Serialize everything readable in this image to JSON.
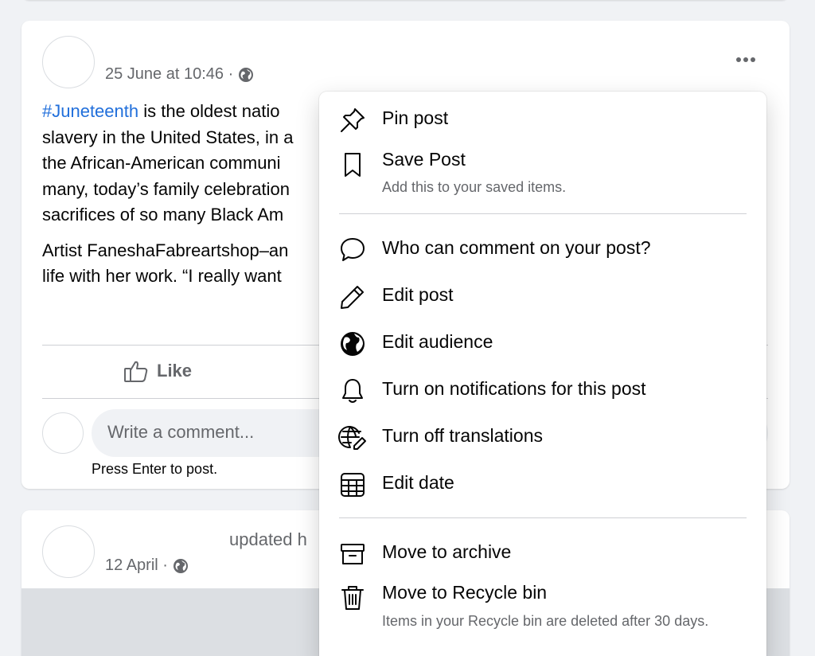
{
  "post1": {
    "timestamp": "25 June at 10:46 ·",
    "hashtag": "#Juneteenth",
    "line1": " is the oldest natio",
    "line2": "slavery in the United States, in a",
    "line3": "the African-American communi",
    "line4": "many, today’s family celebration",
    "line5": "sacrifices of so many Black Am",
    "line6": "Artist FaneshaFabreartshop–an",
    "line7": "life with her work. “I really want",
    "like_label": "Like",
    "comment_placeholder": "Write a comment...",
    "press_enter": "Press Enter to post."
  },
  "post2": {
    "updated_text": "updated h",
    "timestamp": "12 April ·"
  },
  "menu": {
    "pin_post": "Pin post",
    "save_post": "Save Post",
    "save_post_sub": "Add this to your saved items.",
    "who_can_comment": "Who can comment on your post?",
    "edit_post": "Edit post",
    "edit_audience": "Edit audience",
    "turn_on_notifications": "Turn on notifications for this post",
    "turn_off_translations": "Turn off translations",
    "edit_date": "Edit date",
    "move_to_archive": "Move to archive",
    "move_to_recycle_bin": "Move to Recycle bin",
    "recycle_bin_sub": "Items in your Recycle bin are deleted after 30 days."
  }
}
